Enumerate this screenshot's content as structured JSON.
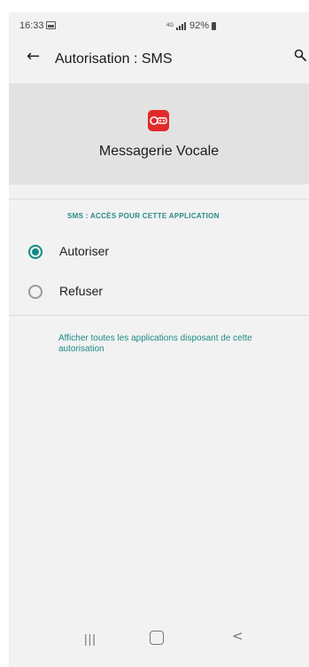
{
  "status_bar": {
    "time": "16:33",
    "network_type": "4G",
    "battery": "92%"
  },
  "app_bar": {
    "title": "Autorisation : SMS"
  },
  "app_header": {
    "app_name": "Messagerie Vocale",
    "logo_color": "#e32a2a"
  },
  "permission": {
    "section_header": "SMS : ACCÈS POUR CETTE APPLICATION",
    "options": [
      {
        "label": "Autoriser",
        "selected": true
      },
      {
        "label": "Refuser",
        "selected": false
      }
    ],
    "link": "Afficher toutes les applications disposant de cette autorisation"
  },
  "colors": {
    "accent": "#148c85",
    "header_bg": "#e2e2e2",
    "page_bg": "#f2f2f2"
  },
  "icons": {
    "back": "arrow-left-icon",
    "search": "search-icon",
    "nav_recent": "recent-apps-icon",
    "nav_home": "home-icon",
    "nav_back": "chevron-left-icon"
  }
}
